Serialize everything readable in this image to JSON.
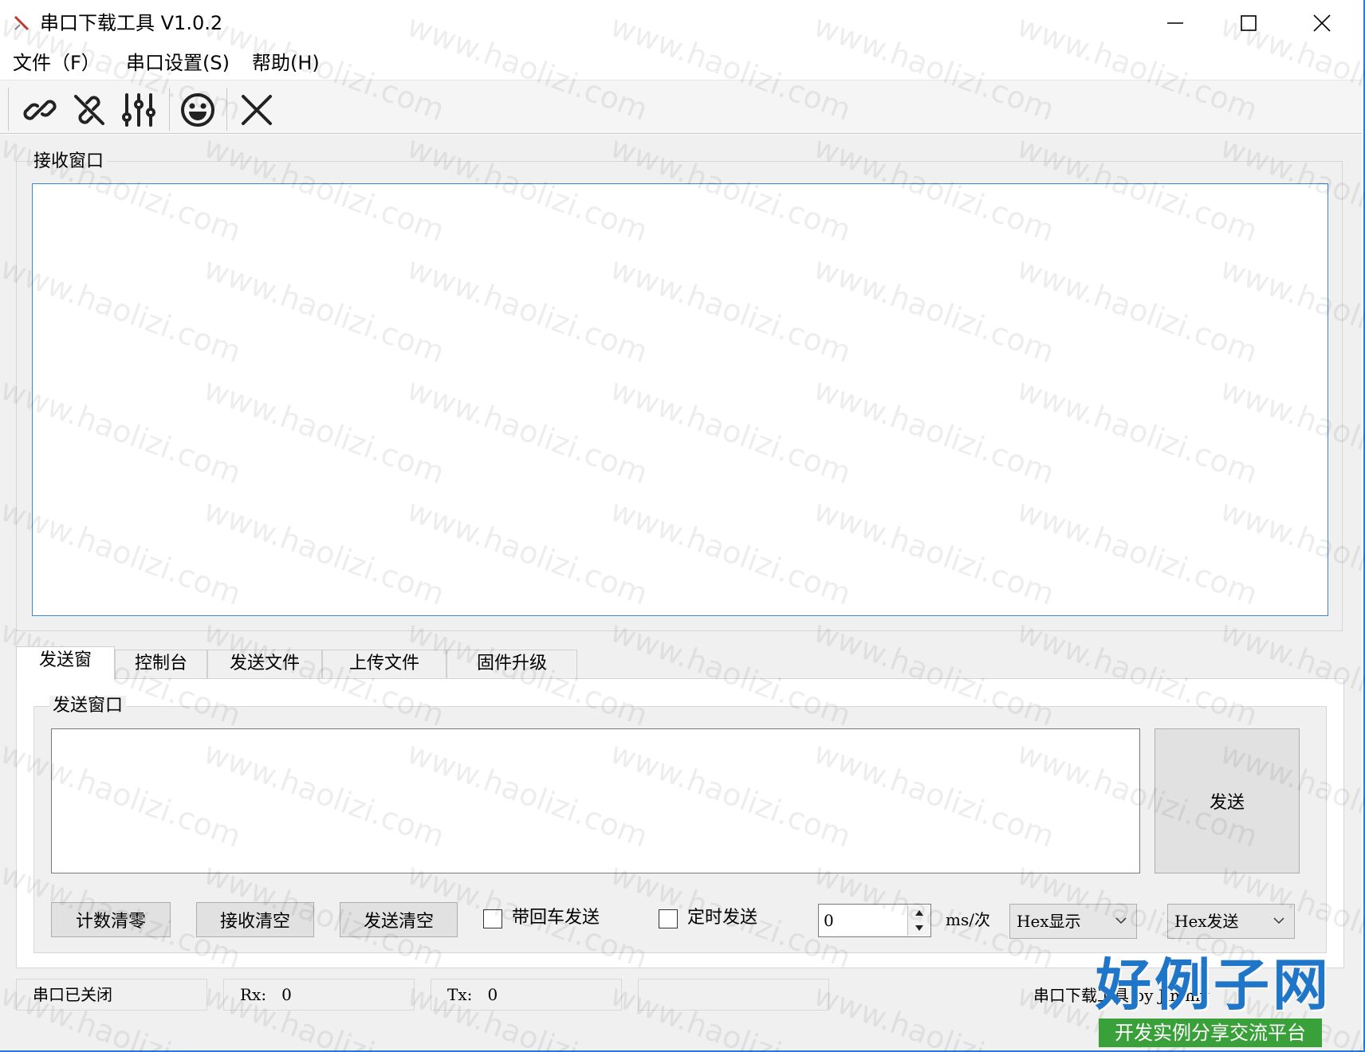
{
  "window": {
    "title": "串口下载工具 V1.0.2"
  },
  "menu": {
    "items": [
      "文件（F）",
      "串口设置(S)",
      "帮助(H)"
    ]
  },
  "toolbar": {
    "icons": [
      "link-icon",
      "unlink-icon",
      "sliders-icon",
      "smiley-icon",
      "close-x-icon"
    ]
  },
  "receive": {
    "group_label": "接收窗口",
    "content": ""
  },
  "tabs": [
    "发送窗",
    "控制台",
    "发送文件",
    "上传文件",
    "固件升级"
  ],
  "send": {
    "group_label": "发送窗口",
    "content": "",
    "send_button": "发送",
    "clear_count_button": "计数清零",
    "clear_receive_button": "接收清空",
    "clear_send_button": "发送清空",
    "crlf_label": "带回车发送",
    "crlf_checked": false,
    "timer_label": "定时发送",
    "timer_checked": false,
    "interval_value": "0",
    "interval_unit": "ms/次",
    "display_mode": "Hex显示",
    "send_mode": "Hex发送"
  },
  "status": {
    "port_state": "串口已关闭",
    "rx_label": "Rx:",
    "rx_value": "0",
    "tx_label": "Tx:",
    "tx_value": "0",
    "extra": "",
    "credit": "串口下载工具 by Jimmy"
  },
  "overlay": {
    "watermark_text": "www.haolizi.com",
    "logo_title": "好例子网",
    "logo_subtitle": "开发实例分享交流平台"
  },
  "colors": {
    "accent": "#2b79d7",
    "logo_blue": "#1f76c8",
    "logo_green": "#3aa13a"
  }
}
